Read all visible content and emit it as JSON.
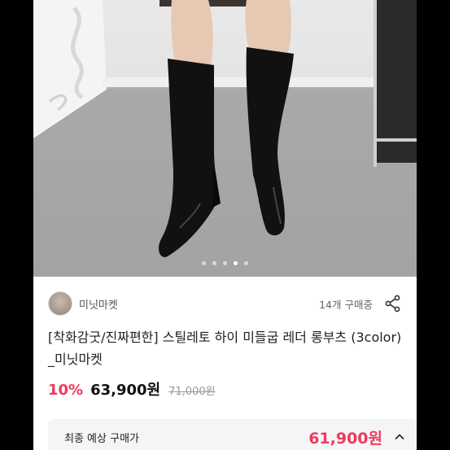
{
  "gallery": {
    "total_slides": 5,
    "active_slide": 4
  },
  "seller": {
    "name": "미닛마켓",
    "buyers_text": "14개 구매중"
  },
  "product": {
    "title": "[착화감굿/진짜편한] 스틸레토 하이 미들굽 레더 롱부츠 (3color) _미닛마켓",
    "discount": "10%",
    "price": "63,900원",
    "original_price": "71,000원"
  },
  "final_price_box": {
    "label": "최종 예상 구매가",
    "price": "61,900원"
  },
  "icons": {
    "share": "share-icon",
    "expand": "chevron-up-icon",
    "seller_avatar": "avatar"
  },
  "colors": {
    "accent": "#ef3a5d",
    "text": "#222222",
    "muted": "#999999"
  }
}
